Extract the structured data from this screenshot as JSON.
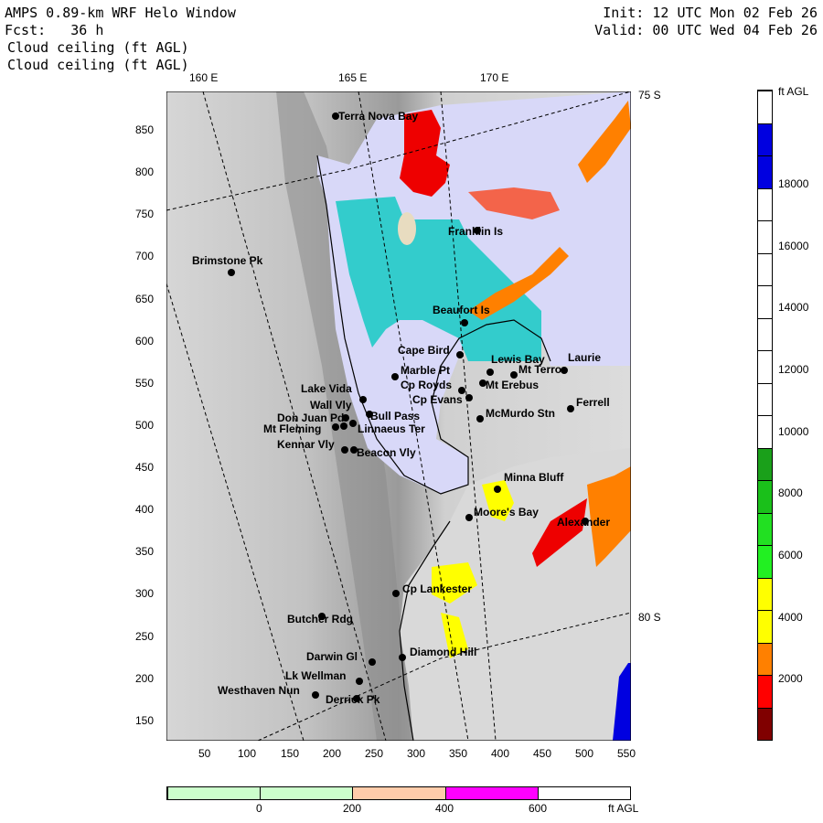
{
  "header": {
    "line1": "AMPS 0.89-km WRF Helo Window",
    "line2": "Fcst:   36 h",
    "line3": "Cloud ceiling (ft AGL)",
    "line4": "Cloud ceiling (ft AGL)",
    "init": "Init: 12 UTC Mon 02 Feb 26",
    "valid": "Valid: 00 UTC Wed 04 Feb 26"
  },
  "longitude_labels": [
    "160 E",
    "165 E",
    "170 E"
  ],
  "latitude_labels": [
    "75 S",
    "80 S"
  ],
  "y_ticks": [
    "850",
    "800",
    "750",
    "700",
    "650",
    "600",
    "550",
    "500",
    "450",
    "400",
    "350",
    "300",
    "250",
    "200",
    "150"
  ],
  "x_ticks": [
    "50",
    "100",
    "150",
    "200",
    "250",
    "300",
    "350",
    "400",
    "450",
    "500",
    "550"
  ],
  "places": [
    {
      "name": "Terra Nova Bay"
    },
    {
      "name": "Franklin Is"
    },
    {
      "name": "Brimstone Pk"
    },
    {
      "name": "Beaufort Is"
    },
    {
      "name": "Cape Bird"
    },
    {
      "name": "Lewis Bay"
    },
    {
      "name": "Laurie"
    },
    {
      "name": "Mt Terror"
    },
    {
      "name": "Marble Pt"
    },
    {
      "name": "Cp Royds"
    },
    {
      "name": "Mt Erebus"
    },
    {
      "name": "Lake Vida"
    },
    {
      "name": "Cp Evans"
    },
    {
      "name": "Ferrell"
    },
    {
      "name": "Wall Vly"
    },
    {
      "name": "Bull Pass"
    },
    {
      "name": "McMurdo Stn"
    },
    {
      "name": "Don Juan Pd"
    },
    {
      "name": "Mt Fleming"
    },
    {
      "name": "Linnaeus Ter"
    },
    {
      "name": "Kennar Vly"
    },
    {
      "name": "Beacon Vly"
    },
    {
      "name": "Minna Bluff"
    },
    {
      "name": "Moore's Bay"
    },
    {
      "name": "Alexander"
    },
    {
      "name": "Cp Lankester"
    },
    {
      "name": "Butcher Rdg"
    },
    {
      "name": "Darwin Gl"
    },
    {
      "name": "Diamond Hill"
    },
    {
      "name": "Lk Wellman"
    },
    {
      "name": "Westhaven Nun"
    },
    {
      "name": "Derrick Pk"
    }
  ],
  "colorbar": {
    "unit": "ft AGL",
    "labels": [
      "18000",
      "16000",
      "14000",
      "12000",
      "10000",
      "8000",
      "6000",
      "4000",
      "2000"
    ],
    "colors": [
      "#ffffff",
      "#0000e0",
      "#0000e0",
      "#ffffff",
      "#ffffff",
      "#ffffff",
      "#ffffff",
      "#ffffff",
      "#ffffff",
      "#ffffff",
      "#ffffff",
      "#1aa01a",
      "#1ac01a",
      "#22e022",
      "#22f022",
      "#ffff00",
      "#ffff00",
      "#ff8000",
      "#ff0000",
      "#800000"
    ]
  },
  "hbar": {
    "unit": "ft AGL",
    "labels": [
      "0",
      "200",
      "400",
      "600"
    ],
    "colors": [
      "#ccffcc",
      "#ccffcc",
      "#ffccaa",
      "#ff00ff",
      "#ffffff"
    ]
  }
}
